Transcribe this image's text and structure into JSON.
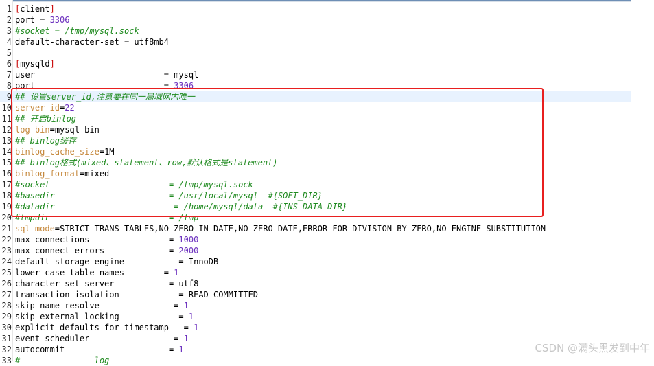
{
  "editor": {
    "current_line": 9,
    "lines": [
      {
        "n": "1",
        "tokens": [
          {
            "c": "t-bracket",
            "t": "["
          },
          {
            "c": "t-text",
            "t": "client"
          },
          {
            "c": "t-bracket",
            "t": "]"
          }
        ]
      },
      {
        "n": "2",
        "tokens": [
          {
            "c": "t-key",
            "t": "port "
          },
          {
            "c": "t-op",
            "t": "= "
          },
          {
            "c": "t-num",
            "t": "3306"
          }
        ]
      },
      {
        "n": "3",
        "tokens": [
          {
            "c": "t-comment",
            "t": "#socket = /tmp/mysql.sock"
          }
        ]
      },
      {
        "n": "4",
        "tokens": [
          {
            "c": "t-key",
            "t": "default-character-set "
          },
          {
            "c": "t-op",
            "t": "= "
          },
          {
            "c": "t-value",
            "t": "utf8mb4"
          }
        ]
      },
      {
        "n": "5",
        "tokens": []
      },
      {
        "n": "6",
        "tokens": [
          {
            "c": "t-bracket",
            "t": "["
          },
          {
            "c": "t-text",
            "t": "mysqld"
          },
          {
            "c": "t-bracket",
            "t": "]"
          }
        ]
      },
      {
        "n": "7",
        "tokens": [
          {
            "c": "t-key",
            "t": "user                          "
          },
          {
            "c": "t-op",
            "t": "= "
          },
          {
            "c": "t-value",
            "t": "mysql"
          }
        ]
      },
      {
        "n": "8",
        "tokens": [
          {
            "c": "t-key",
            "t": "port                          "
          },
          {
            "c": "t-op",
            "t": "= "
          },
          {
            "c": "t-num",
            "t": "3306"
          }
        ]
      },
      {
        "n": "9",
        "tokens": [
          {
            "c": "t-comment",
            "t": "## 设置server_id,注意要在同一局域网内唯一"
          }
        ]
      },
      {
        "n": "10",
        "tokens": [
          {
            "c": "t-key-orange",
            "t": "server-id"
          },
          {
            "c": "t-op",
            "t": "="
          },
          {
            "c": "t-num",
            "t": "22"
          }
        ]
      },
      {
        "n": "11",
        "tokens": [
          {
            "c": "t-comment",
            "t": "## 开启binlog"
          }
        ]
      },
      {
        "n": "12",
        "tokens": [
          {
            "c": "t-key-orange",
            "t": "log-bin"
          },
          {
            "c": "t-op",
            "t": "="
          },
          {
            "c": "t-value",
            "t": "mysql-bin"
          }
        ]
      },
      {
        "n": "13",
        "tokens": [
          {
            "c": "t-comment",
            "t": "## binlog缓存"
          }
        ]
      },
      {
        "n": "14",
        "tokens": [
          {
            "c": "t-key-orange",
            "t": "binlog_cache_size"
          },
          {
            "c": "t-op",
            "t": "="
          },
          {
            "c": "t-value",
            "t": "1M"
          }
        ]
      },
      {
        "n": "15",
        "tokens": [
          {
            "c": "t-comment",
            "t": "## binlog格式(mixed、statement、row,默认格式是statement)"
          }
        ]
      },
      {
        "n": "16",
        "tokens": [
          {
            "c": "t-key-orange",
            "t": "binlog_format"
          },
          {
            "c": "t-op",
            "t": "="
          },
          {
            "c": "t-value",
            "t": "mixed"
          }
        ]
      },
      {
        "n": "17",
        "tokens": [
          {
            "c": "t-comment",
            "t": "#socket                        = /tmp/mysql.sock"
          }
        ]
      },
      {
        "n": "18",
        "tokens": [
          {
            "c": "t-comment",
            "t": "#basedir                       = /usr/local/mysql  #{SOFT_DIR}"
          }
        ]
      },
      {
        "n": "19",
        "tokens": [
          {
            "c": "t-comment",
            "t": "#datadir                        = /home/mysql/data  #{INS_DATA_DIR}"
          }
        ]
      },
      {
        "n": "20",
        "tokens": [
          {
            "c": "t-comment",
            "t": "#tmpdir                        = /tmp"
          }
        ]
      },
      {
        "n": "21",
        "tokens": [
          {
            "c": "t-key-orange",
            "t": "sql_mode"
          },
          {
            "c": "t-op",
            "t": "="
          },
          {
            "c": "t-value",
            "t": "STRICT_TRANS_TABLES,NO_ZERO_IN_DATE,NO_ZERO_DATE,ERROR_FOR_DIVISION_BY_ZERO,NO_ENGINE_SUBSTITUTION"
          }
        ]
      },
      {
        "n": "22",
        "tokens": [
          {
            "c": "t-key",
            "t": "max_connections                "
          },
          {
            "c": "t-op",
            "t": "= "
          },
          {
            "c": "t-num",
            "t": "1000"
          }
        ]
      },
      {
        "n": "23",
        "tokens": [
          {
            "c": "t-key",
            "t": "max_connect_errors             "
          },
          {
            "c": "t-op",
            "t": "= "
          },
          {
            "c": "t-num",
            "t": "2000"
          }
        ]
      },
      {
        "n": "24",
        "tokens": [
          {
            "c": "t-key",
            "t": "default-storage-engine           "
          },
          {
            "c": "t-op",
            "t": "= "
          },
          {
            "c": "t-value",
            "t": "InnoDB"
          }
        ]
      },
      {
        "n": "25",
        "tokens": [
          {
            "c": "t-key",
            "t": "lower_case_table_names        "
          },
          {
            "c": "t-op",
            "t": "= "
          },
          {
            "c": "t-num",
            "t": "1"
          }
        ]
      },
      {
        "n": "26",
        "tokens": [
          {
            "c": "t-key",
            "t": "character_set_server           "
          },
          {
            "c": "t-op",
            "t": "= "
          },
          {
            "c": "t-value",
            "t": "utf8"
          }
        ]
      },
      {
        "n": "27",
        "tokens": [
          {
            "c": "t-key",
            "t": "transaction-isolation            "
          },
          {
            "c": "t-op",
            "t": "= "
          },
          {
            "c": "t-value",
            "t": "READ-COMMITTED"
          }
        ]
      },
      {
        "n": "28",
        "tokens": [
          {
            "c": "t-key",
            "t": "skip-name-resolve               "
          },
          {
            "c": "t-op",
            "t": "= "
          },
          {
            "c": "t-num",
            "t": "1"
          }
        ]
      },
      {
        "n": "29",
        "tokens": [
          {
            "c": "t-key",
            "t": "skip-external-locking            "
          },
          {
            "c": "t-op",
            "t": "= "
          },
          {
            "c": "t-num",
            "t": "1"
          }
        ]
      },
      {
        "n": "30",
        "tokens": [
          {
            "c": "t-key",
            "t": "explicit_defaults_for_timestamp   "
          },
          {
            "c": "t-op",
            "t": "= "
          },
          {
            "c": "t-num",
            "t": "1"
          }
        ]
      },
      {
        "n": "31",
        "tokens": [
          {
            "c": "t-key",
            "t": "event_scheduler                 "
          },
          {
            "c": "t-op",
            "t": "= "
          },
          {
            "c": "t-num",
            "t": "1"
          }
        ]
      },
      {
        "n": "32",
        "tokens": [
          {
            "c": "t-key",
            "t": "autocommit                     "
          },
          {
            "c": "t-op",
            "t": "= "
          },
          {
            "c": "t-num",
            "t": "1"
          }
        ]
      },
      {
        "n": "33",
        "tokens": [
          {
            "c": "t-comment",
            "t": "#               log"
          }
        ]
      }
    ]
  },
  "watermark": "CSDN @满头黑发到中年"
}
